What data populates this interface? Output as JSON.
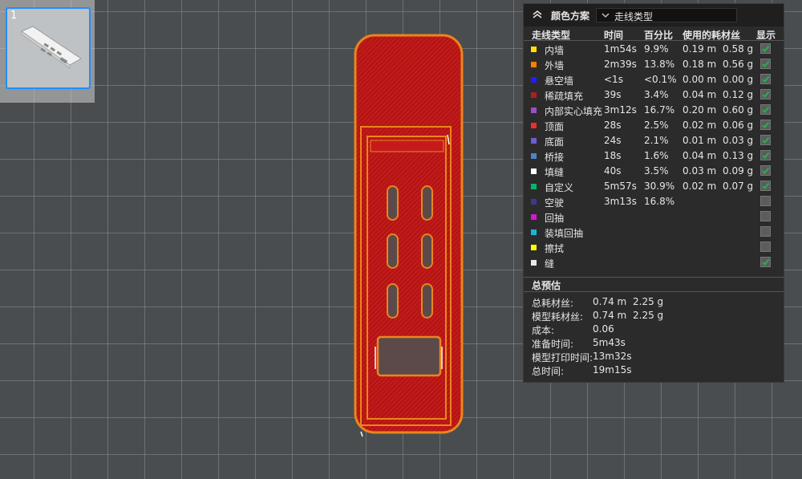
{
  "plate": {
    "number": "1"
  },
  "panel": {
    "scheme_label": "颜色方案",
    "scheme_value": "走线类型",
    "headers": {
      "type": "走线类型",
      "time": "时间",
      "percent": "百分比",
      "filament": "使用的耗材丝",
      "show": "显示"
    },
    "rows": [
      {
        "name": "内墙",
        "color": "#ffe100",
        "time": "1m54s",
        "percent": "9.9%",
        "length": "0.19 m",
        "weight": "0.58 g",
        "shown": true
      },
      {
        "name": "外墙",
        "color": "#ff7d00",
        "time": "2m39s",
        "percent": "13.8%",
        "length": "0.18 m",
        "weight": "0.56 g",
        "shown": true
      },
      {
        "name": "悬空墙",
        "color": "#1f1fff",
        "time": "<1s",
        "percent": "<0.1%",
        "length": "0.00 m",
        "weight": "0.00 g",
        "shown": true
      },
      {
        "name": "稀疏填充",
        "color": "#b01d1d",
        "time": "39s",
        "percent": "3.4%",
        "length": "0.04 m",
        "weight": "0.12 g",
        "shown": true
      },
      {
        "name": "内部实心填充",
        "color": "#9a4fc6",
        "time": "3m12s",
        "percent": "16.7%",
        "length": "0.20 m",
        "weight": "0.60 g",
        "shown": true
      },
      {
        "name": "顶面",
        "color": "#ef2b2b",
        "time": "28s",
        "percent": "2.5%",
        "length": "0.02 m",
        "weight": "0.06 g",
        "shown": true
      },
      {
        "name": "底面",
        "color": "#6b5ed6",
        "time": "24s",
        "percent": "2.1%",
        "length": "0.01 m",
        "weight": "0.03 g",
        "shown": true
      },
      {
        "name": "桥接",
        "color": "#4d84c8",
        "time": "18s",
        "percent": "1.6%",
        "length": "0.04 m",
        "weight": "0.13 g",
        "shown": true
      },
      {
        "name": "填缝",
        "color": "#ffffff",
        "time": "40s",
        "percent": "3.5%",
        "length": "0.03 m",
        "weight": "0.09 g",
        "shown": true
      },
      {
        "name": "自定义",
        "color": "#00b86b",
        "time": "5m57s",
        "percent": "30.9%",
        "length": "0.02 m",
        "weight": "0.07 g",
        "shown": true
      },
      {
        "name": "空驶",
        "color": "#3b3b8c",
        "time": "3m13s",
        "percent": "16.8%",
        "length": "",
        "weight": "",
        "shown": false
      },
      {
        "name": "回抽",
        "color": "#d417d4",
        "time": "",
        "percent": "",
        "length": "",
        "weight": "",
        "shown": false
      },
      {
        "name": "装填回抽",
        "color": "#17b7d4",
        "time": "",
        "percent": "",
        "length": "",
        "weight": "",
        "shown": false
      },
      {
        "name": "擦拭",
        "color": "#ffff00",
        "time": "",
        "percent": "",
        "length": "",
        "weight": "",
        "shown": false
      },
      {
        "name": "缝",
        "color": "#e8e8e8",
        "time": "",
        "percent": "",
        "length": "",
        "weight": "",
        "shown": true
      }
    ],
    "summary_title": "总预估",
    "summary": [
      {
        "label": "总耗材丝:",
        "v1": "0.74 m",
        "v2": "2.25 g"
      },
      {
        "label": "模型耗材丝:",
        "v1": "0.74 m",
        "v2": "2.25 g"
      },
      {
        "label": "成本:",
        "v1": "0.06",
        "v2": ""
      },
      {
        "label": "准备时间:",
        "v1": "5m43s",
        "v2": ""
      },
      {
        "label": "模型打印时间:",
        "v1": "13m32s",
        "v2": ""
      },
      {
        "label": "总时间:",
        "v1": "19m15s",
        "v2": ""
      }
    ]
  }
}
